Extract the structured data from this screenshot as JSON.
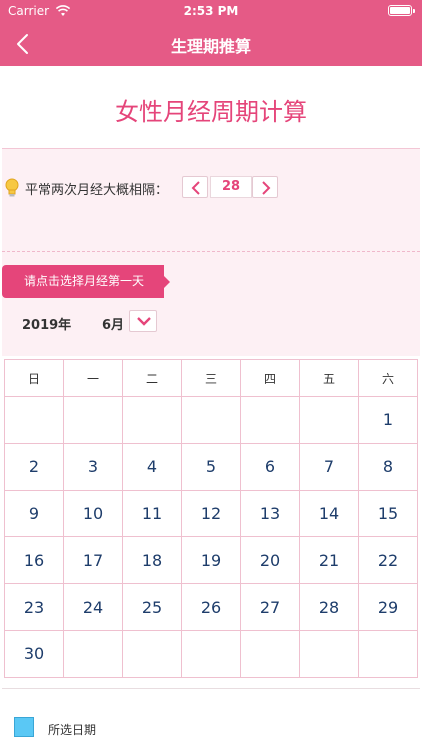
{
  "status_bar": {
    "carrier": "Carrier",
    "time": "2:53 PM"
  },
  "nav": {
    "title": "生理期推算",
    "back_icon": "chevron-left-icon"
  },
  "main_title": "女性月经周期计算",
  "interval": {
    "label": "平常两次月经大概相隔：",
    "value": "28",
    "icon": "lightbulb-icon"
  },
  "hint": "请点击选择月经第一天",
  "picker": {
    "year": "2019年",
    "month": "6月",
    "dropdown_icon": "chevron-down-icon"
  },
  "calendar": {
    "weekdays": [
      "日",
      "一",
      "二",
      "三",
      "四",
      "五",
      "六"
    ],
    "weeks": [
      [
        "",
        "",
        "",
        "",
        "",
        "",
        "1"
      ],
      [
        "2",
        "3",
        "4",
        "5",
        "6",
        "7",
        "8"
      ],
      [
        "9",
        "10",
        "11",
        "12",
        "13",
        "14",
        "15"
      ],
      [
        "16",
        "17",
        "18",
        "19",
        "20",
        "21",
        "22"
      ],
      [
        "23",
        "24",
        "25",
        "26",
        "27",
        "28",
        "29"
      ],
      [
        "30",
        "",
        "",
        "",
        "",
        "",
        ""
      ]
    ]
  },
  "legend": {
    "label": "所选日期",
    "color": "#5ac8f5"
  },
  "colors": {
    "primary": "#e55a86",
    "accent": "#e5457a",
    "day_text": "#1e3d6b"
  }
}
